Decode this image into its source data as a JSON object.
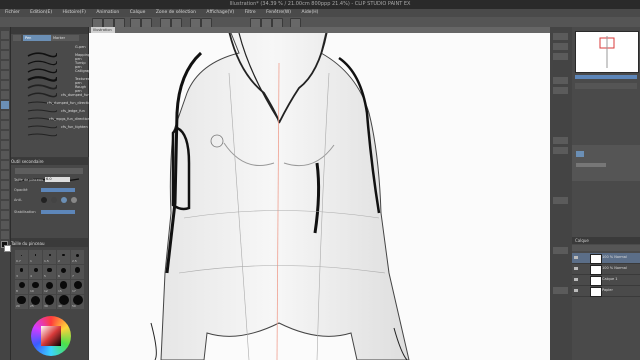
{
  "window": {
    "title": "Illustration* (34.39 % / 21.00cm 800ppp 21.4%) - CLIP STUDIO PAINT EX"
  },
  "menu": {
    "items": [
      "Fichier",
      "Edition(E)",
      "Histoire(F)",
      "Animation",
      "Calque",
      "Zone de sélection",
      "Affichage(V)",
      "Filtre",
      "Fenêtre(W)",
      "Aide(H)"
    ]
  },
  "canvas_tab": {
    "label": "Illustration"
  },
  "sub_tool": {
    "tab_label": "Pen",
    "tab2_label": "Marker",
    "brushes": [
      "G-pen",
      "Mapping pen",
      "Turnip pen",
      "Calligraphy",
      "Textured pen",
      "Rough pen",
      "cfs_dumped_fun",
      "cfs_dumped_fun_directional",
      "cfs_jedge_fun",
      "cfs_mpgs_fun_directional",
      "cfs_fun_tighten"
    ]
  },
  "tool_property": {
    "head": "Outil secondaire",
    "labels": [
      "Taille de pinceau",
      "Opacité",
      "Anti-",
      "Stabilisation"
    ],
    "size_value": "6.0"
  },
  "brush_size": {
    "head": "Taille du pinceau",
    "sizes": [
      "0.7",
      "1",
      "1.5",
      "2",
      "2.5",
      "3",
      "4",
      "5",
      "6",
      "7",
      "8",
      "10",
      "12",
      "15",
      "17",
      "20",
      "25",
      "30",
      "40",
      "50"
    ]
  },
  "layers": {
    "head": "Calque",
    "items": [
      {
        "name": "100 % Normal"
      },
      {
        "name": "100 % Normal"
      },
      {
        "name": "Calque 1"
      },
      {
        "name": "Papier"
      }
    ]
  },
  "colors": {
    "accent_red": "#d83a3a",
    "panel": "#4a4a4a",
    "canvas": "#fbfbfb"
  }
}
